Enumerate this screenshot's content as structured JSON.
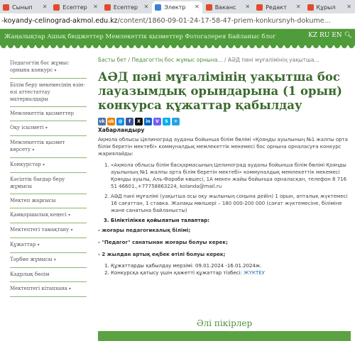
{
  "browser": {
    "tabs": [
      {
        "label": "Сынып",
        "color": "#e24a2b",
        "active": false
      },
      {
        "label": "Есептер",
        "color": "#e24a2b",
        "active": false
      },
      {
        "label": "Есептер",
        "color": "#e24a2b",
        "active": false
      },
      {
        "label": "Электр",
        "color": "#3b82d6",
        "active": true
      },
      {
        "label": "Ваканс",
        "color": "#e24a2b",
        "active": false
      },
      {
        "label": "Редакт",
        "color": "#e24a2b",
        "active": false
      },
      {
        "label": "Құрыл",
        "color": "#e24a2b",
        "active": false
      }
    ],
    "url_host": "-koyandy-celinograd-akmol.edu.kz",
    "url_path": "/content/1860-09-01-24-17-58-47-priem-konkursnyh-dokume..."
  },
  "site": {
    "header_nav": "Жаңалықтар Ашық бюджеттер Мемлекеттік қызметтер Фотогалерея Байланыс блог",
    "lang": "KZ RU EN"
  },
  "sidebar": {
    "items": [
      {
        "label": "Педагогтің бос жұмыс орнына конкурс",
        "has_arrow": true
      },
      {
        "label": "Білім беру мекемесінің өзін-өзі аттестаттау материалдары",
        "has_arrow": false
      },
      {
        "label": "Мемлекеттік қызметтер",
        "has_arrow": false
      },
      {
        "label": "Оқу ісызметі",
        "has_arrow": true
      },
      {
        "label": "Мемлекеттік қызмет көрсету",
        "has_arrow": true
      },
      {
        "label": "Конкурстар",
        "has_arrow": true
      },
      {
        "label": "Кәсіптік бағдар беру жұмысы",
        "has_arrow": false
      },
      {
        "label": "Мектеп жарғысы",
        "has_arrow": false
      },
      {
        "label": "Қамқоршылық кеңесі",
        "has_arrow": true
      },
      {
        "label": "Мектептегі тамақтану",
        "has_arrow": true
      },
      {
        "label": "Құжаттар",
        "has_arrow": true
      },
      {
        "label": "Тәрбие жұмысы",
        "has_arrow": true
      },
      {
        "label": "Кадрлық бөлім",
        "has_arrow": false
      },
      {
        "label": "Мектептегі кітапхана",
        "has_arrow": true
      }
    ]
  },
  "main": {
    "breadcrumb": {
      "home": "Басты бет",
      "sep": "/",
      "section": "Педагогтің бос жұмыс орнына...",
      "current": "АӘД пәні мұғалімінің уақытша..."
    },
    "title": "АӘД пәні мұғалімінің уақытша бос лауазымдық орындарына (1 орын) конкурса құжаттар қабылдау",
    "share_icons": [
      {
        "name": "vk-icon",
        "glyph": "vk",
        "color": "#4c75a3"
      },
      {
        "name": "odnoklassniki-icon",
        "glyph": "ok",
        "color": "#ee8208"
      },
      {
        "name": "mailru-icon",
        "glyph": "@",
        "color": "#168de2"
      },
      {
        "name": "facebook-icon",
        "glyph": "f",
        "color": "#3b5998"
      },
      {
        "name": "x-icon",
        "glyph": "X",
        "color": "#111111"
      },
      {
        "name": "linkedin-icon",
        "glyph": "in",
        "color": "#0a66c2"
      },
      {
        "name": "viber-icon",
        "glyph": "V",
        "color": "#7360f2"
      },
      {
        "name": "skype-icon",
        "glyph": "S",
        "color": "#00aff0"
      },
      {
        "name": "telegram-icon",
        "glyph": "✈",
        "color": "#2aa3df"
      }
    ],
    "subtitle": "Хабарландыру",
    "intro": "Ақмола облысы Целиноград ауданы бойынша білім бөлімі «Қояңды ауылының №1 жалпы орта білім беретін мектебі» коммуналдық мемлекеттік мекемесі бос орнына орналасуға конкурс жариялайды:",
    "items": [
      "«Ақмола облысы білім басқармасының Целиноград ауданы бойынша білім бөлімі Қояңды ауылының №1 жалпы орта білім беретін мектебі» коммуналдық мемлекеттік мекемесі Қояңды ауылы, Аль-Фараби көшесі, 1А мекен жайы бойынша орналасқан, телефон 8 716 51 46601.,+77758863224, kolanda@mail.ru",
      "АӘД пәні мұғалімі (уақытша осы оқу жылының соңына дейін) 1 орын, апталық жүктемесі 16 сағаттан, 1 ставка. Жалақы мөлшері – 180 000-200 000 (сағат жүктемесіне, біліміне және санатына байланысты)",
      "Біліктілікке қойылатын талаптар:"
    ],
    "requirements": [
      "- жоғары педагогикалық білімі;",
      "- \"Педагог\" санатынан жоғары болуы керек;",
      "- 2 жылдан артық еңбек өтілі болуы керек;"
    ],
    "dates_label": "Құжаттарды қабылдау мерзімі: 09.01.2024 -16.01.2024ж.",
    "docs_label": "Конкурсқа қатысу үшін қажетті құжаттар тізбесі:",
    "docs_link": "ЖҮКТЕУ",
    "comments": "Әлі пікірлер"
  }
}
